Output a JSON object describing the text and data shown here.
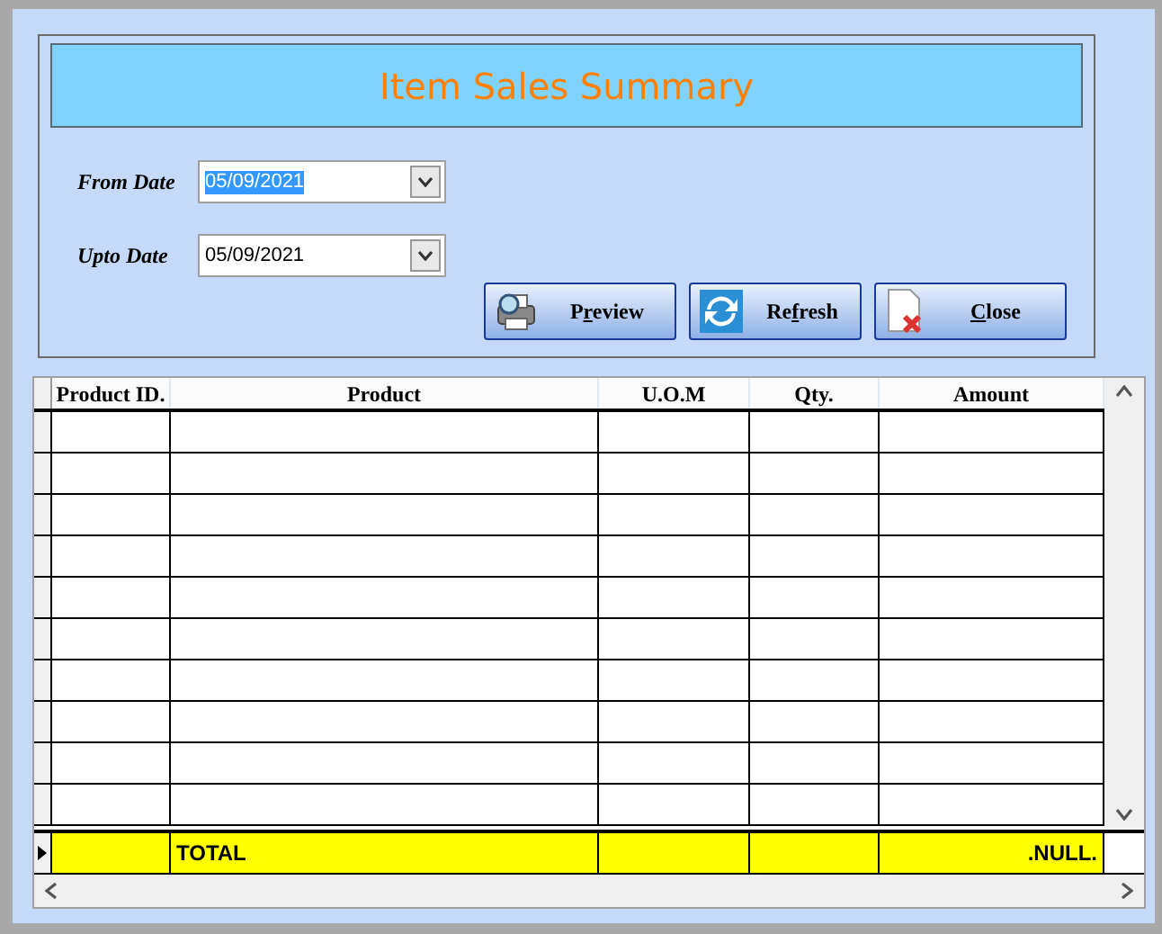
{
  "title": "Item Sales Summary",
  "date_fields": [
    {
      "label": "From Date",
      "value": "05/09/2021",
      "selected": true
    },
    {
      "label": "Upto Date",
      "value": "05/09/2021",
      "selected": false
    }
  ],
  "buttons": [
    {
      "kind": "preview",
      "before": "P",
      "key": "r",
      "after": "eview"
    },
    {
      "kind": "refresh",
      "before": "Re",
      "key": "f",
      "after": "resh"
    },
    {
      "kind": "close",
      "key": "C",
      "after": "lose"
    }
  ],
  "table": {
    "columns": [
      "Product ID.",
      "Product",
      "U.O.M",
      "Qty.",
      "Amount"
    ],
    "total_row": {
      "current": true,
      "label": "TOTAL",
      "amount": ".NULL."
    }
  }
}
